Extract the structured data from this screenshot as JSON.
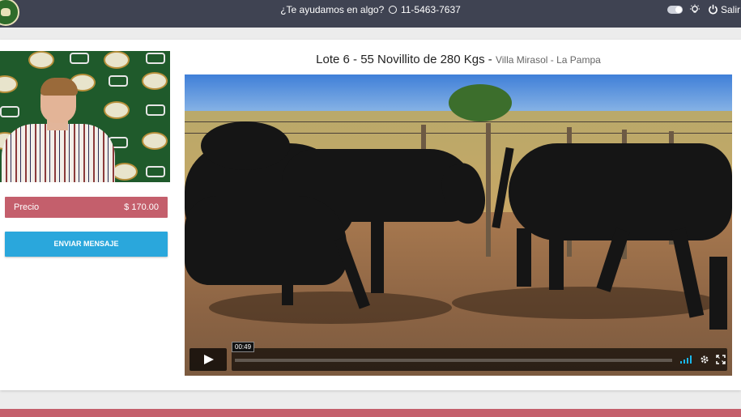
{
  "header": {
    "help_text": "¿Te ayudamos en algo?",
    "phone": "11-5463-7637",
    "logout_label": "Salir"
  },
  "sidebar": {
    "price_label": "Precio",
    "price_value": "$ 170.00",
    "send_button": "ENVIAR MENSAJE"
  },
  "lot": {
    "title": "Lote 6 - 55 Novillito de 280 Kgs -",
    "location": "Villa Mirasol - La Pampa"
  },
  "video": {
    "time": "00:49"
  },
  "icons": {
    "whatsapp": "whatsapp-icon",
    "theme_toggle": "toggle-icon",
    "bulb": "lightbulb-icon",
    "power": "power-icon",
    "play": "play-icon",
    "volume": "volume-icon",
    "settings": "gear-icon",
    "fullscreen": "fullscreen-icon"
  },
  "colors": {
    "topbar": "#3f4352",
    "price_bar": "#c45f6c",
    "send_button": "#2aa7dc",
    "accent_volume": "#1ab7ea"
  }
}
